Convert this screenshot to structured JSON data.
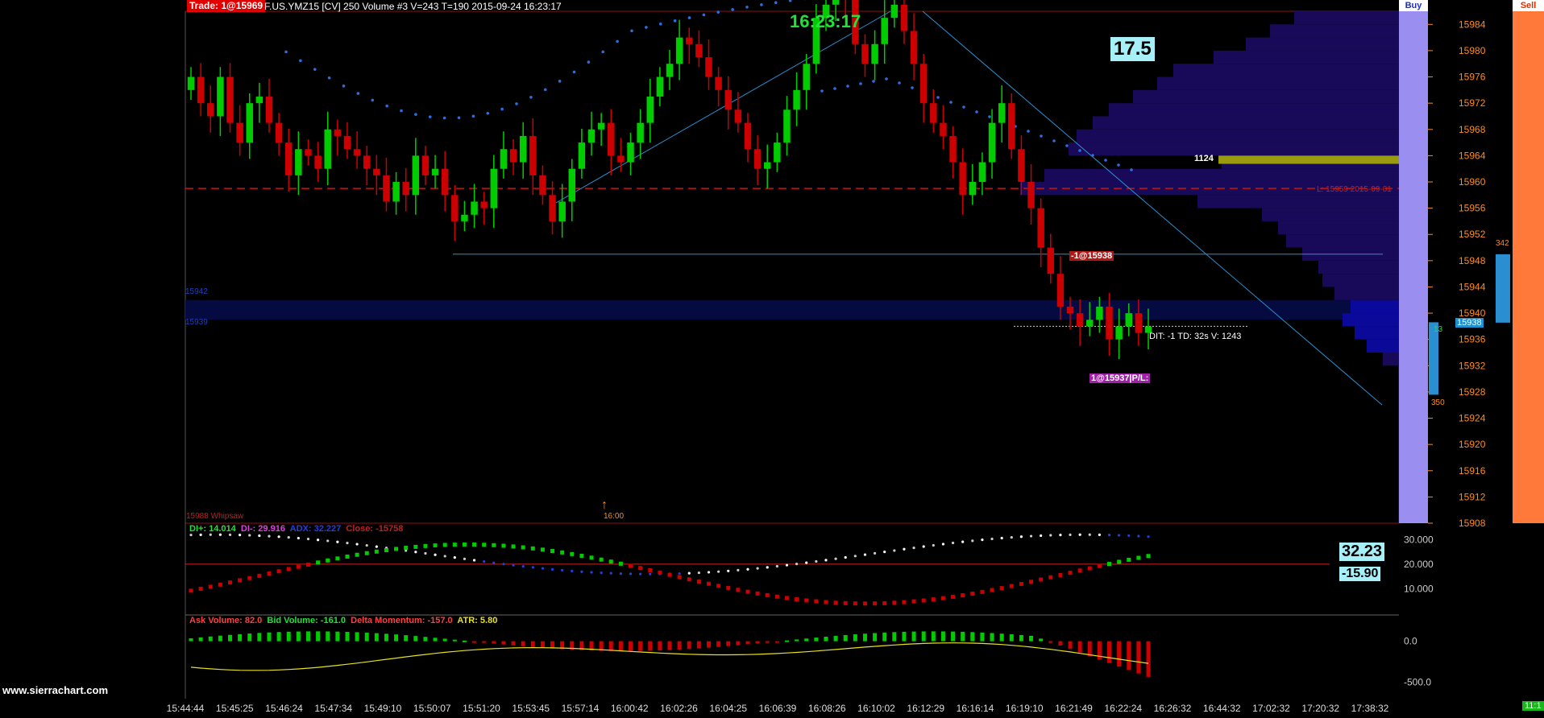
{
  "header": {
    "trade_badge": "Trade: 1@15969",
    "symbol_info": "F.US.YMZ15 [CV]  250 Volume  #3 V=243 T=190 2015-09-24 16:23:17"
  },
  "buttons": {
    "buy": "Buy",
    "sell": "Sell"
  },
  "clock": "16:23:17",
  "value_box": "17.5",
  "watermark": "www.sierrachart.com",
  "annotations": {
    "profile_peak": "1124",
    "l_line": "L: 15959  2015-09-01",
    "sell_fill": "-1@15938",
    "buy_fill": "1@15937|P/L:",
    "dit": "DIT: -1  TD: 32s  V: 1243",
    "zone_top": "15942",
    "zone_bot": "15939",
    "whipsaw": "15988 Whipsaw",
    "marker_time": "16:00",
    "current_price": "15938",
    "dom_top": "342",
    "dom_bot": "350",
    "dom_small": "13",
    "corner": "11:1"
  },
  "colors": {
    "background": "#000000",
    "up_candle": "#00cc00",
    "down_candle": "#cc0000",
    "trend_line": "#2a8fd0",
    "profile": "#1a0a5e",
    "buy_button": "#9a8ff0",
    "sell_button": "#ff7a3a",
    "price_axis": "#ff8c1a"
  },
  "chart_data": [
    {
      "type": "candlestick",
      "title": "F.US.YMZ15 [CV] 250 Volume",
      "y_ticks": [
        "15984",
        "15980",
        "15976",
        "15972",
        "15968",
        "15964",
        "15960",
        "15956",
        "15952",
        "15948",
        "15944",
        "15940",
        "15936",
        "15932",
        "15928",
        "15924",
        "15920",
        "15916",
        "15912",
        "15908"
      ],
      "x_ticks": [
        "15:44:44",
        "15:45:25",
        "15:46:24",
        "15:47:34",
        "15:49:10",
        "15:50:07",
        "15:51:20",
        "15:53:45",
        "15:57:14",
        "16:00:42",
        "16:02:26",
        "16:04:25",
        "16:06:39",
        "16:08:26",
        "16:10:02",
        "16:12:29",
        "16:16:14",
        "16:19:10",
        "16:21:49",
        "16:22:24",
        "16:26:32",
        "16:44:32",
        "17:02:32",
        "17:20:32",
        "17:38:32"
      ],
      "ylim": [
        15908,
        15986
      ],
      "close": [
        15976,
        15972,
        15970,
        15976,
        15969,
        15966,
        15972,
        15973,
        15969,
        15966,
        15961,
        15965,
        15964,
        15962,
        15968,
        15967,
        15965,
        15964,
        15962,
        15961,
        15957,
        15960,
        15958,
        15964,
        15961,
        15962,
        15958,
        15954,
        15955,
        15957,
        15956,
        15962,
        15965,
        15963,
        15967,
        15961,
        15958,
        15954,
        15957,
        15962,
        15966,
        15968,
        15969,
        15964,
        15963,
        15966,
        15969,
        15973,
        15976,
        15978,
        15982,
        15981,
        15979,
        15976,
        15974,
        15971,
        15969,
        15965,
        15962,
        15963,
        15966,
        15971,
        15974,
        15978,
        15985,
        15987,
        15991,
        15988,
        15981,
        15978,
        15981,
        15985,
        15987,
        15983,
        15978,
        15972,
        15969,
        15967,
        15963,
        15958,
        15960,
        15963,
        15969,
        15972,
        15965,
        15960,
        15956,
        15950,
        15946,
        15941,
        15940,
        15938,
        15939,
        15941,
        15936,
        15938,
        15940,
        15937,
        15938
      ],
      "open": [
        15974,
        15976,
        15972,
        15970,
        15976,
        15969,
        15966,
        15972,
        15973,
        15969,
        15966,
        15961,
        15965,
        15964,
        15962,
        15968,
        15967,
        15965,
        15964,
        15962,
        15961,
        15957,
        15960,
        15958,
        15964,
        15961,
        15962,
        15958,
        15954,
        15955,
        15957,
        15956,
        15962,
        15965,
        15963,
        15967,
        15961,
        15958,
        15954,
        15957,
        15962,
        15966,
        15968,
        15969,
        15964,
        15963,
        15966,
        15969,
        15973,
        15976,
        15978,
        15982,
        15981,
        15979,
        15976,
        15974,
        15971,
        15969,
        15965,
        15962,
        15963,
        15966,
        15971,
        15974,
        15978,
        15985,
        15987,
        15991,
        15988,
        15981,
        15978,
        15981,
        15985,
        15987,
        15983,
        15978,
        15972,
        15969,
        15967,
        15963,
        15958,
        15960,
        15963,
        15969,
        15972,
        15965,
        15960,
        15956,
        15950,
        15946,
        15941,
        15940,
        15938,
        15939,
        15941,
        15936,
        15938,
        15940,
        15937
      ],
      "profile_peak_price": 15963,
      "profile_peak_volume": 1124,
      "last_price": 15938
    },
    {
      "type": "line",
      "title": "DI / ADX",
      "series_labels": {
        "diplus": "DI+: 14.014",
        "diminus": "DI-: 29.916",
        "adx": "ADX: 32.227",
        "close": "Close: -15758"
      },
      "y_ticks": [
        "30.000",
        "20.000",
        "10.000"
      ],
      "ylim": [
        0,
        36
      ],
      "reference_line": 20,
      "badge_top": "32.23",
      "badge_bottom": "-15.90"
    },
    {
      "type": "bar",
      "title": "Volume / Delta",
      "series_labels": {
        "ask": "Ask Volume: 82.0",
        "bid": "Bid Volume: -161.0",
        "delta": "Delta Momentum: -157.0",
        "atr": "ATR: 5.80"
      },
      "y_ticks": [
        "0.0",
        "-500.0"
      ],
      "ylim": [
        -700,
        300
      ]
    }
  ]
}
